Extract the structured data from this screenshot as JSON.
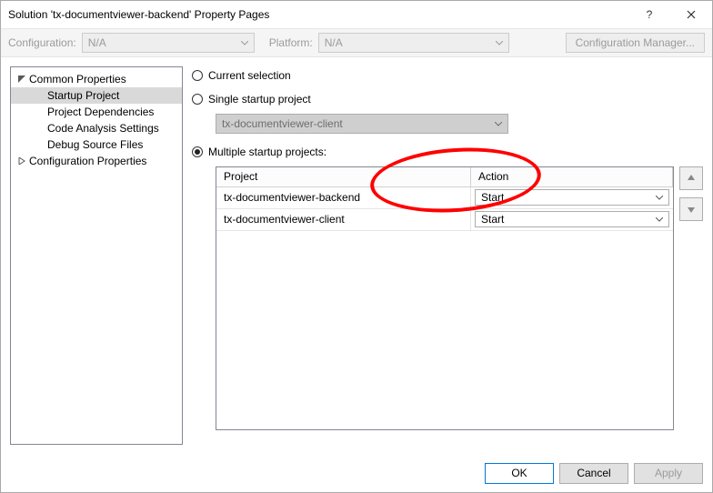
{
  "title": "Solution 'tx-documentviewer-backend' Property Pages",
  "toolbar": {
    "config_label": "Configuration:",
    "config_value": "N/A",
    "platform_label": "Platform:",
    "platform_value": "N/A",
    "manager_label": "Configuration Manager..."
  },
  "tree": {
    "common": "Common Properties",
    "startup": "Startup Project",
    "deps": "Project Dependencies",
    "code": "Code Analysis Settings",
    "debug": "Debug Source Files",
    "config": "Configuration Properties"
  },
  "radios": {
    "current": "Current selection",
    "single": "Single startup project",
    "single_value": "tx-documentviewer-client",
    "multiple": "Multiple startup projects:"
  },
  "grid": {
    "col_project": "Project",
    "col_action": "Action",
    "rows": [
      {
        "project": "tx-documentviewer-backend",
        "action": "Start"
      },
      {
        "project": "tx-documentviewer-client",
        "action": "Start"
      }
    ]
  },
  "buttons": {
    "ok": "OK",
    "cancel": "Cancel",
    "apply": "Apply"
  }
}
